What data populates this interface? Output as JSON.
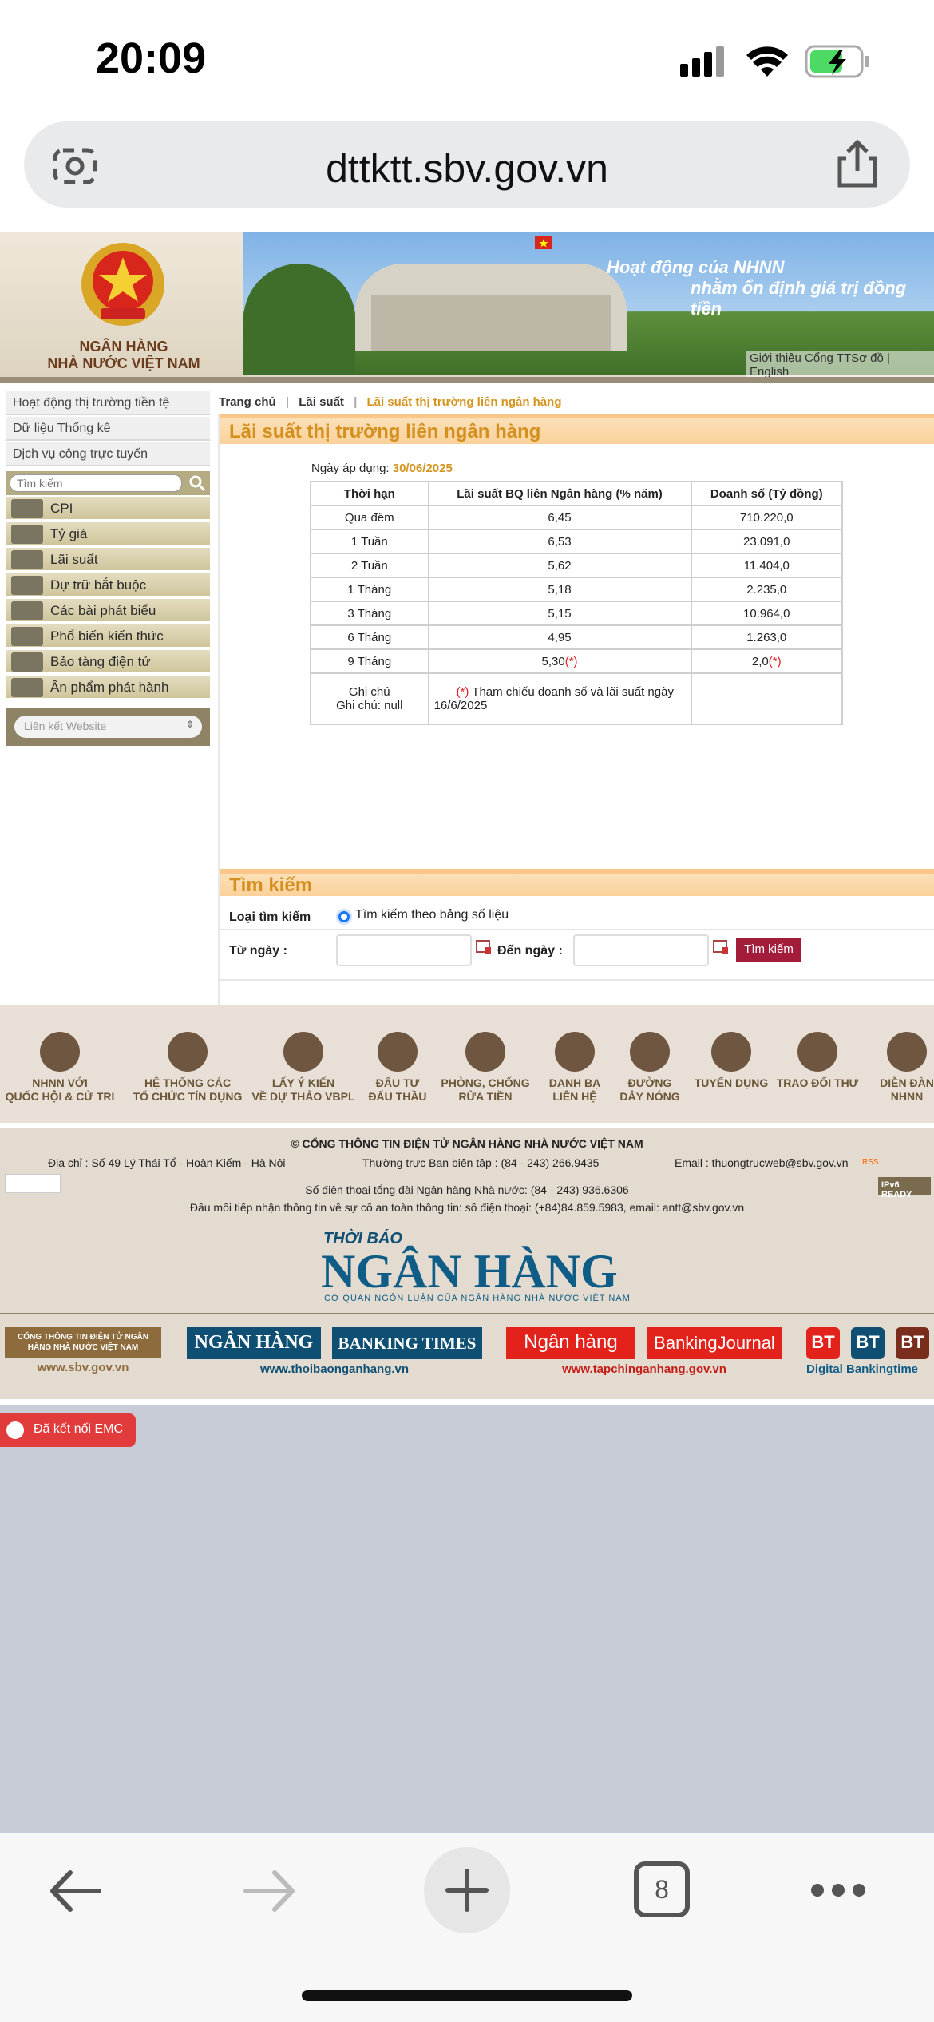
{
  "status": {
    "time": "20:09"
  },
  "browser": {
    "url": "dttktt.sbv.gov.vn",
    "tabs_count": "8"
  },
  "banner": {
    "org_line1": "NGÂN HÀNG",
    "org_line2": "NHÀ NƯỚC VIỆT NAM",
    "slogan1": "Hoạt động của NHNN",
    "slogan2": "nhằm ổn định giá trị đồng tiền",
    "links": "Giới thiệu Cổng TTSơ đồ | English"
  },
  "sidebar": {
    "top_items": [
      "Hoạt động thị trường tiền tệ",
      "Dữ liệu Thống kê",
      "Dịch vụ công trực tuyến"
    ],
    "search_placeholder": "Tìm kiếm",
    "menu": [
      "CPI",
      "Tỷ giá",
      "Lãi suất",
      "Dự trữ bắt buộc",
      "Các bài phát biểu",
      "Phổ biến kiến thức",
      "Bảo tàng điện tử",
      "Ấn phẩm phát hành"
    ],
    "link_select": "Liên kết Website"
  },
  "breadcrumb": {
    "home": "Trang chủ",
    "sep": "|",
    "section": "Lãi suất",
    "current": "Lãi suất thị trường liên ngân hàng"
  },
  "main": {
    "title": "Lãi suất thị trường liên ngân hàng",
    "date_label": "Ngày áp dụng:",
    "date_value": "30/06/2025",
    "headers": [
      "Thời hạn",
      "Lãi suất BQ liên Ngân hàng (% năm)",
      "Doanh số (Tỷ đồng)"
    ],
    "rows": [
      [
        "Qua đêm",
        "6,45",
        "710.220,0"
      ],
      [
        "1 Tuần",
        "6,53",
        "23.091,0"
      ],
      [
        "2 Tuần",
        "5,62",
        "11.404,0"
      ],
      [
        "1 Tháng",
        "5,18",
        "2.235,0"
      ],
      [
        "3 Tháng",
        "5,15",
        "10.964,0"
      ],
      [
        "6 Tháng",
        "4,95",
        "1.263,0"
      ],
      [
        "9 Tháng",
        "5,30",
        "2,0"
      ]
    ],
    "star": "(*)",
    "note_label1": "Ghi chú",
    "note_label2": "Ghi chú: null",
    "note_text": "Tham chiếu doanh số và lãi suất ngày 16/6/2025"
  },
  "search": {
    "title": "Tìm kiếm",
    "type_label": "Loại tìm kiếm",
    "type_option": "Tìm kiếm theo bảng số liệu",
    "from_label": "Từ ngày :",
    "to_label": "Đến ngày :",
    "button": "Tìm kiếm"
  },
  "footer_icons": [
    {
      "line1": "NHNN VỚI",
      "line2": "QUỐC HỘI & CỬ TRI"
    },
    {
      "line1": "HỆ THỐNG CÁC",
      "line2": "TỔ CHỨC TÍN DỤNG"
    },
    {
      "line1": "LẤY Ý KIẾN",
      "line2": "VỀ DỰ THẢO VBPL"
    },
    {
      "line1": "ĐẤU TƯ",
      "line2": "ĐẤU THẦU"
    },
    {
      "line1": "PHÒNG, CHỐNG",
      "line2": "RỬA TIỀN"
    },
    {
      "line1": "DANH BẠ",
      "line2": "LIÊN HỆ"
    },
    {
      "line1": "ĐƯỜNG",
      "line2": "DÂY NÓNG"
    },
    {
      "line1": "TUYỂN DỤNG",
      "line2": ""
    },
    {
      "line1": "TRAO ĐỔI THƯ",
      "line2": ""
    },
    {
      "line1": "DIỄN ĐÀN",
      "line2": "NHNN"
    }
  ],
  "footer": {
    "copyright": "© CỔNG THÔNG TIN ĐIỆN TỬ NGÂN HÀNG NHÀ NƯỚC VIỆT NAM",
    "address": "Địa chỉ : Số 49 Lý Thái Tổ - Hoàn Kiếm - Hà Nội",
    "editor": "Thường trực Ban biên tập : (84 - 243) 266.9435",
    "email": "Email : thuongtrucweb@sbv.gov.vn",
    "rss": "RSS",
    "ipv6": "IPv6 READY",
    "switchboard": "Số điện thoại tổng đài Ngân hàng Nhà nước: (84 - 243) 936.6306",
    "security": "Đầu mối tiếp nhận thông tin về sự cố an toàn thông tin: số điện thoại: (+84)84.859.5983, email: antt@sbv.gov.vn",
    "logo_top": "THỜI BÁO",
    "logo_main": "NGÂN HÀNG",
    "logo_sub": "CƠ QUAN NGÔN LUẬN CỦA NGÂN HÀNG NHÀ NƯỚC VIỆT NAM"
  },
  "partners": {
    "sbv_box": "CỔNG THÔNG TIN ĐIỆN TỬ NGÂN HÀNG NHÀ NƯỚC VIỆT NAM",
    "sbv_url": "www.sbv.gov.vn",
    "nh_box": "NGÂN HÀNG",
    "bt_box": "BANKING TIMES",
    "tbnh_url": "www.thoibaonganhang.vn",
    "tc_box1": "Ngân hàng",
    "tc_box2": "BankingJournal",
    "tc_url": "www.tapchinganhang.gov.vn",
    "bt1": "BT",
    "bt2": "BT",
    "bt3": "BT",
    "digital": "Digital Bankingtime"
  },
  "emc": "Đã kết nối EMC"
}
